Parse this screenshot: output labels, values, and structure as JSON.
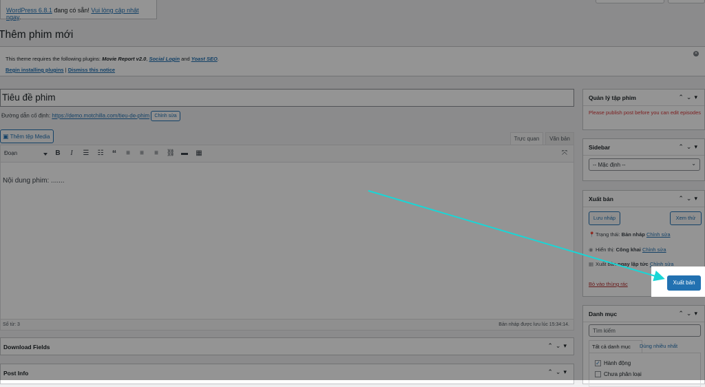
{
  "update_nag": {
    "version_link": "WordPress 6.8.1",
    "middle": " đang có sẵn! ",
    "update_link": "Vui lòng cập nhật ngay",
    "end": "."
  },
  "page_title": "Thêm phim mới",
  "notice": {
    "line_prefix": "This theme requires the following plugins: ",
    "plugin1": "Movie Report v2.0",
    "sep1": ", ",
    "plugin2": "Social Login",
    "sep2": " and ",
    "plugin3": "Yoast SEO",
    "end": ".",
    "begin_link": "Begin installing plugins",
    "divider": " | ",
    "dismiss_link": "Dismiss this notice"
  },
  "title_placeholder": "Tiêu đề phim",
  "permalink": {
    "label": "Đường dẫn cố định: ",
    "url": "https://demo.motchilla.com/tieu-de-phim",
    "edit": "Chỉnh sửa"
  },
  "media_button": "Thêm tệp Media",
  "editor_tabs": {
    "visual": "Trực quan",
    "text": "Văn bản"
  },
  "toolbar": {
    "format": "Đoạn",
    "icons": [
      "bold-icon",
      "italic-icon",
      "bulleted-list-icon",
      "numbered-list-icon",
      "blockquote-icon",
      "align-left-icon",
      "align-center-icon",
      "align-right-icon",
      "link-icon",
      "read-more-icon",
      "toolbar-toggle-icon"
    ]
  },
  "editor_content": "Nội dung phim: .......",
  "status_bar": {
    "word_count": "Số từ: 3",
    "draft_saved": "Bản nháp được lưu lúc 15:34:14."
  },
  "bottom_boxes": [
    "Download Fields",
    "Post Info"
  ],
  "sidebar": {
    "episodes": {
      "title": "Quản lý tập phim",
      "message": "Please publish post before you can edit episodes"
    },
    "sidebar_box": {
      "title": "Sidebar",
      "selected": "-- Mặc định --"
    },
    "publish": {
      "title": "Xuất bản",
      "save_draft": "Lưu nháp",
      "preview": "Xem thử",
      "status_label": "Trạng thái: ",
      "status_value": "Bản nháp",
      "visibility_label": "Hiển thị: ",
      "visibility_value": "Công khai",
      "schedule_label": "Xuất bản ",
      "schedule_value": "ngay lập tức",
      "edit": "Chỉnh sửa",
      "trash": "Bỏ vào thùng rác",
      "publish_button": "Xuất bản"
    },
    "categories": {
      "title": "Danh mục",
      "search_placeholder": "Tìm kiếm",
      "tab_all": "Tất cả danh mục",
      "tab_popular": "Dùng nhiều nhất",
      "items": [
        {
          "label": "Hành động",
          "checked": true
        },
        {
          "label": "Chưa phân loại",
          "checked": false
        }
      ]
    }
  },
  "colors": {
    "accent": "#2271b1",
    "arrow": "#19d6d6",
    "error": "#d63638"
  }
}
